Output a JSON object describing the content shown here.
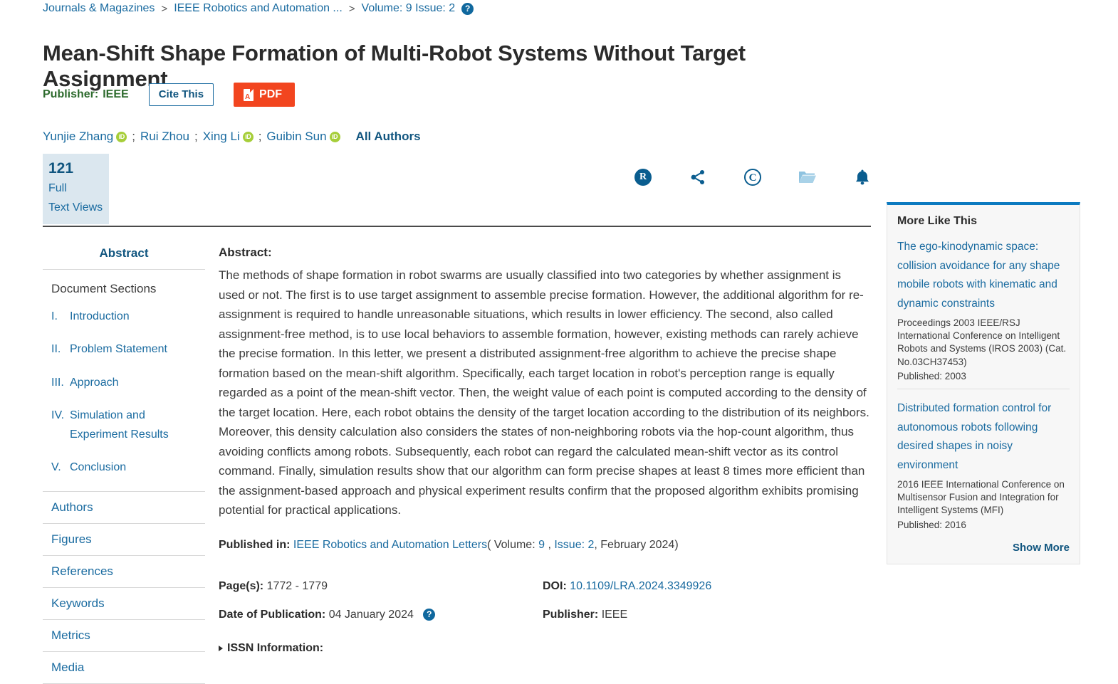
{
  "breadcrumb": {
    "items": [
      {
        "label": "Journals & Magazines"
      },
      {
        "label": "IEEE Robotics and Automation ..."
      },
      {
        "label": "Volume: 9 Issue: 2"
      }
    ],
    "separator": ">",
    "help_icon": "help-icon",
    "help_glyph": "?"
  },
  "header": {
    "title": "Mean-Shift Shape Formation of Multi-Robot Systems Without Target Assignment",
    "publisher_label": "Publisher:",
    "publisher_value": "IEEE",
    "cite_label": "Cite This",
    "pdf_label": "PDF",
    "pdf_icon": "pdf-file-icon",
    "accent_orange": "#f2451f",
    "accent_blue": "#1a6ba0",
    "publisher_green": "#2e6b2e"
  },
  "authors": {
    "list": [
      {
        "name": "Yunjie Zhang",
        "orcid": true
      },
      {
        "name": "Rui Zhou",
        "orcid": false
      },
      {
        "name": "Xing Li",
        "orcid": true
      },
      {
        "name": "Guibin Sun",
        "orcid": true
      }
    ],
    "separator": ";",
    "orcid_glyph": "iD",
    "all_authors_label": "All Authors"
  },
  "metrics": {
    "count": "121",
    "line1": "Full",
    "line2": "Text Views",
    "background": "#dbe7ef"
  },
  "action_icons": [
    {
      "name": "research-alerts-icon",
      "glyph": "R"
    },
    {
      "name": "share-icon",
      "glyph": ""
    },
    {
      "name": "copyright-icon",
      "glyph": "C"
    },
    {
      "name": "folder-icon",
      "glyph": ""
    },
    {
      "name": "alerts-bell-icon",
      "glyph": ""
    }
  ],
  "sidebar": {
    "abstract_label": "Abstract",
    "doc_sections_label": "Document Sections",
    "sections": [
      {
        "num": "I.",
        "label": "Introduction"
      },
      {
        "num": "II.",
        "label": "Problem Statement"
      },
      {
        "num": "III.",
        "label": "Approach"
      },
      {
        "num": "IV.",
        "label": "Simulation and Experiment Results"
      },
      {
        "num": "V.",
        "label": "Conclusion"
      }
    ],
    "items": [
      {
        "label": "Authors"
      },
      {
        "label": "Figures"
      },
      {
        "label": "References"
      },
      {
        "label": "Keywords"
      },
      {
        "label": "Metrics"
      },
      {
        "label": "Media"
      }
    ]
  },
  "abstract": {
    "label": "Abstract:",
    "text": "The methods of shape formation in robot swarms are usually classified into two categories by whether assignment is used or not. The first is to use target assignment to assemble precise formation. However, the additional algorithm for re-assignment is required to handle unreasonable situations, which results in lower efficiency. The second, also called assignment-free method, is to use local behaviors to assemble formation, however, existing methods can rarely achieve the precise formation. In this letter, we present a distributed assignment-free algorithm to achieve the precise shape formation based on the mean-shift algorithm. Specifically, each target location in robot's perception range is equally regarded as a point of the mean-shift vector. Then, the weight value of each point is computed according to the density of the target location. Here, each robot obtains the density of the target location according to the distribution of its neighbors. Moreover, this density calculation also considers the states of non-neighboring robots via the hop-count algorithm, thus avoiding conflicts among robots. Subsequently, each robot can regard the calculated mean-shift vector as its control command. Finally, simulation results show that our algorithm can form precise shapes at least 8 times more efficient than the assignment-based approach and physical experiment results confirm that the proposed algorithm exhibits promising potential for practical applications."
  },
  "publication": {
    "published_in_label": "Published in:",
    "journal": "IEEE Robotics and Automation Letters",
    "volume_prefix": "( Volume: ",
    "volume": "9",
    "issue_label": "Issue: 2",
    "issue_suffix": ", February 2024)",
    "pages_label": "Page(s):",
    "pages_value": "1772 - 1779",
    "doi_label": "DOI:",
    "doi_value": "10.1109/LRA.2024.3349926",
    "date_label": "Date of Publication:",
    "date_value": "04 January 2024",
    "publisher_label": "Publisher:",
    "publisher_value": "IEEE",
    "issn_label": "ISSN Information:"
  },
  "more_like_this": {
    "title": "More Like This",
    "items": [
      {
        "title": "The ego-kinodynamic space: collision avoidance for any shape mobile robots with kinematic and dynamic constraints",
        "source": "Proceedings 2003 IEEE/RSJ International Conference on Intelligent Robots and Systems (IROS 2003) (Cat. No.03CH37453)",
        "published": "Published: 2003"
      },
      {
        "title": "Distributed formation control for autonomous robots following desired shapes in noisy environment",
        "source": "2016 IEEE International Conference on Multisensor Fusion and Integration for Intelligent Systems (MFI)",
        "published": "Published: 2016"
      }
    ],
    "show_more_label": "Show More",
    "top_border_color": "#0c7ac0"
  }
}
